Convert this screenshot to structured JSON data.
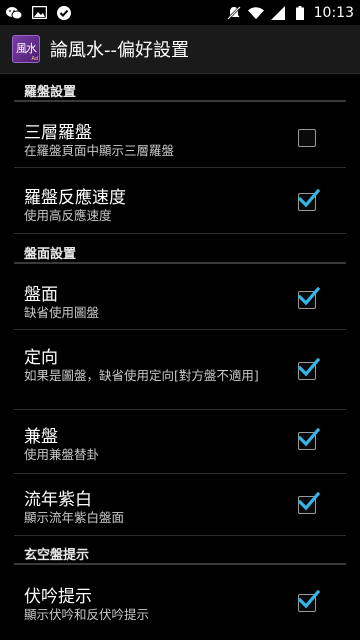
{
  "status_bar": {
    "time": "10:13",
    "icons": [
      "wechat-icon",
      "image-icon",
      "check-circle-icon",
      "mute-icon",
      "wifi-icon",
      "signal-icon",
      "battery-icon"
    ]
  },
  "action_bar": {
    "app_icon_text": "風水",
    "app_icon_subtext": "Ad",
    "title": "論風水--偏好設置"
  },
  "sections": {
    "compass": {
      "header": "羅盤設置"
    },
    "plate": {
      "header": "盤面設置"
    },
    "xuankong": {
      "header": "玄空盤提示"
    }
  },
  "prefs": {
    "three_layer": {
      "title": "三層羅盤",
      "summary": "在羅盤頁面中顯示三層羅盤",
      "checked": false
    },
    "compass_speed": {
      "title": "羅盤反應速度",
      "summary": "使用高反應速度",
      "checked": true
    },
    "plate": {
      "title": "盤面",
      "summary": "缺省使用圖盤",
      "checked": true
    },
    "direction": {
      "title": "定向",
      "summary": "如果是圖盤，缺省使用定向[對方盤不適用]",
      "checked": true
    },
    "jianpan": {
      "title": "兼盤",
      "summary": "使用兼盤替卦",
      "checked": true
    },
    "liunian": {
      "title": "流年紫白",
      "summary": "顯示流年紫白盤面",
      "checked": true
    },
    "fuyin": {
      "title": "伏吟提示",
      "summary": "顯示伏吟和反伏吟提示",
      "checked": true
    }
  },
  "colors": {
    "check": "#33b5e5",
    "background": "#000000"
  }
}
